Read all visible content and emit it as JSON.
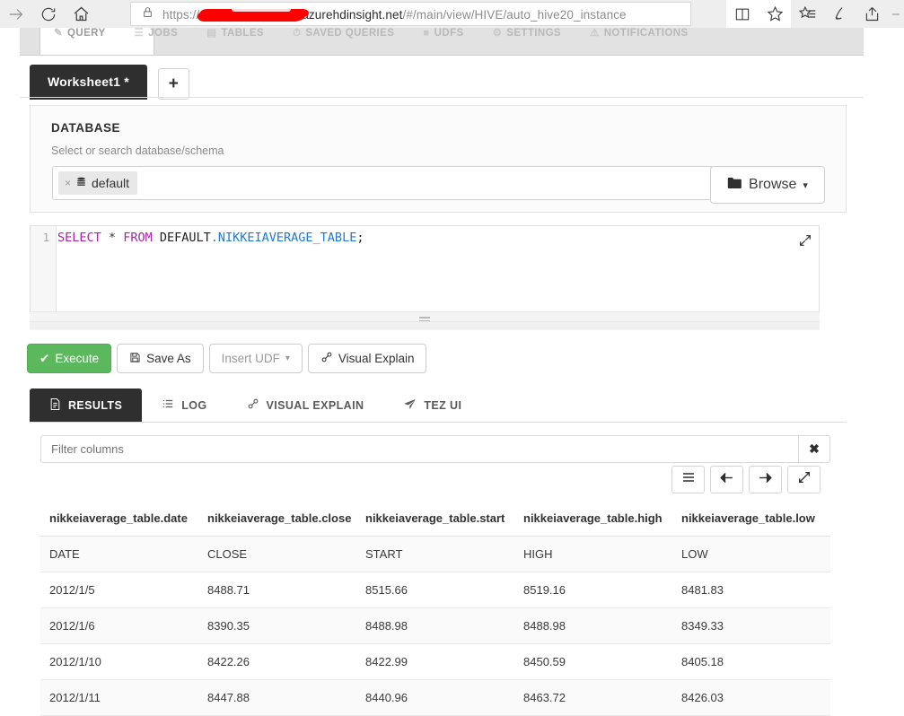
{
  "browser": {
    "url_prefix": "https://",
    "url_host": "azurehdinsight.net",
    "url_path": "/#/main/view/HIVE/auto_hive20_instance",
    "forward_label": "Forward",
    "refresh_label": "Refresh",
    "home_label": "Home",
    "reading_view_label": "Reading view",
    "favorite_label": "Add to favorites",
    "hub_label": "Hub",
    "web_note_label": "Make a Web Note",
    "share_label": "Share"
  },
  "ambari_nav": {
    "items": [
      {
        "label": "QUERY",
        "icon": "pencil-icon"
      },
      {
        "label": "JOBS",
        "icon": "tasks-icon"
      },
      {
        "label": "TABLES",
        "icon": "table-icon"
      },
      {
        "label": "SAVED QUERIES",
        "icon": "clock-icon"
      },
      {
        "label": "UDFS",
        "icon": "cube-icon"
      },
      {
        "label": "SETTINGS",
        "icon": "gear-icon"
      },
      {
        "label": "NOTIFICATIONS",
        "icon": "bell-icon"
      }
    ]
  },
  "worksheet": {
    "tab_label": "Worksheet1 *",
    "add_label": "+"
  },
  "database": {
    "title": "DATABASE",
    "subtitle": "Select or search database/schema",
    "chip_remove": "×",
    "chip_label": "default",
    "browse_label": "Browse",
    "browse_caret": "▾"
  },
  "editor": {
    "line_number": "1",
    "tokens": {
      "select": "SELECT",
      "star": "*",
      "from": "FROM",
      "schema": "DEFAULT",
      "dot_table": ".NIKKEIAVERAGE_TABLE",
      "semicolon": ";"
    },
    "expand_label": "Expand editor"
  },
  "actions": {
    "execute": "Execute",
    "save_as": "Save As",
    "insert_udf": "Insert UDF",
    "insert_udf_caret": "▾",
    "visual_explain": "Visual Explain"
  },
  "result_tabs": [
    {
      "label": "RESULTS",
      "icon": "file-text-icon",
      "active": true
    },
    {
      "label": "LOG",
      "icon": "list-icon",
      "active": false
    },
    {
      "label": "VISUAL EXPLAIN",
      "icon": "link-icon",
      "active": false
    },
    {
      "label": "TEZ UI",
      "icon": "paper-plane-icon",
      "active": false
    }
  ],
  "filter": {
    "placeholder": "Filter columns",
    "value": "",
    "clear_label": "✖"
  },
  "grid_toolbar": [
    {
      "name": "column-list-button",
      "icon": "hamburger-icon"
    },
    {
      "name": "previous-page-button",
      "icon": "arrow-left-icon"
    },
    {
      "name": "next-page-button",
      "icon": "arrow-right-icon"
    },
    {
      "name": "fullscreen-button",
      "icon": "expand-icon"
    }
  ],
  "results": {
    "columns": [
      "nikkeiaverage_table.date",
      "nikkeiaverage_table.close",
      "nikkeiaverage_table.start",
      "nikkeiaverage_table.high",
      "nikkeiaverage_table.low"
    ],
    "rows": [
      [
        "DATE",
        "CLOSE",
        "START",
        "HIGH",
        "LOW"
      ],
      [
        "2012/1/5",
        "8488.71",
        "8515.66",
        "8519.16",
        "8481.83"
      ],
      [
        "2012/1/6",
        "8390.35",
        "8488.98",
        "8488.98",
        "8349.33"
      ],
      [
        "2012/1/10",
        "8422.26",
        "8422.99",
        "8450.59",
        "8405.18"
      ],
      [
        "2012/1/11",
        "8447.88",
        "8440.96",
        "8463.72",
        "8426.03"
      ]
    ]
  },
  "colors": {
    "accent_green": "#5cb85c",
    "tab_dark": "#2f2f2f",
    "sql_keyword": "#a625a6",
    "sql_table": "#1f7ad4",
    "redaction": "#fe0000"
  }
}
